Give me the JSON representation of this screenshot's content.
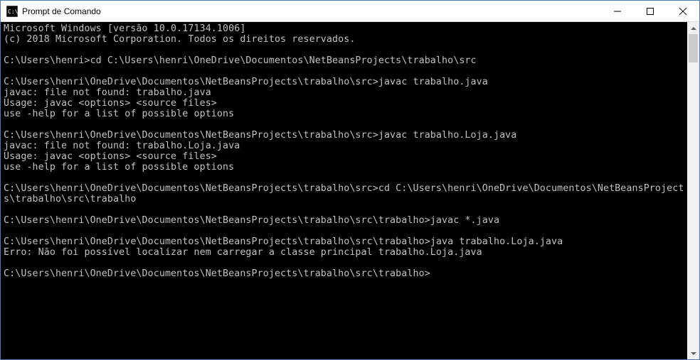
{
  "window": {
    "title": "Prompt de Comando",
    "icon": "cmd-icon"
  },
  "terminal": {
    "lines": [
      "Microsoft Windows [versão 10.0.17134.1006]",
      "(c) 2018 Microsoft Corporation. Todos os direitos reservados.",
      "",
      "C:\\Users\\henri>cd C:\\Users\\henri\\OneDrive\\Documentos\\NetBeansProjects\\trabalho\\src",
      "",
      "C:\\Users\\henri\\OneDrive\\Documentos\\NetBeansProjects\\trabalho\\src>javac trabalho.java",
      "javac: file not found: trabalho.java",
      "Usage: javac <options> <source files>",
      "use -help for a list of possible options",
      "",
      "C:\\Users\\henri\\OneDrive\\Documentos\\NetBeansProjects\\trabalho\\src>javac trabalho.Loja.java",
      "javac: file not found: trabalho.Loja.java",
      "Usage: javac <options> <source files>",
      "use -help for a list of possible options",
      "",
      "C:\\Users\\henri\\OneDrive\\Documentos\\NetBeansProjects\\trabalho\\src>cd C:\\Users\\henri\\OneDrive\\Documentos\\NetBeansProjects\\trabalho\\src\\trabalho",
      "",
      "C:\\Users\\henri\\OneDrive\\Documentos\\NetBeansProjects\\trabalho\\src\\trabalho>javac *.java",
      "",
      "C:\\Users\\henri\\OneDrive\\Documentos\\NetBeansProjects\\trabalho\\src\\trabalho>java trabalho.Loja.java",
      "Erro: Não foi possível localizar nem carregar a classe principal trabalho.Loja.java",
      "",
      "C:\\Users\\henri\\OneDrive\\Documentos\\NetBeansProjects\\trabalho\\src\\trabalho>"
    ]
  }
}
